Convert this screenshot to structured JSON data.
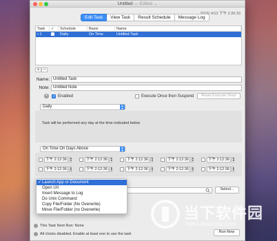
{
  "window": {
    "title": "Untitled",
    "edited": "— Edited ⌄",
    "clock": "2016/ 4/13 下午 2:26:33"
  },
  "tabs": [
    {
      "label": "Edit Task",
      "active": true
    },
    {
      "label": "View Task",
      "active": false
    },
    {
      "label": "Result Schedule",
      "active": false
    },
    {
      "label": "Message Log",
      "active": false
    }
  ],
  "task_table": {
    "columns": [
      "Task",
      "✓",
      "Schedule",
      "Basis",
      "Name"
    ],
    "rows": [
      {
        "task": "• 1",
        "checked": true,
        "schedule": "Daily",
        "basis": "On Time",
        "name": "Untitled Task"
      }
    ]
  },
  "table_controls": {
    "add": "+",
    "remove": "−"
  },
  "form": {
    "name_label": "Name:",
    "name_value": "Untitled Task",
    "note_label": "Note:",
    "note_value": "Untitled Note",
    "info_icon": "x",
    "enabled_label": "Enabled",
    "execute_once_label": "Execute Once then Suspend",
    "reset_button": "Reset Execute Once"
  },
  "schedule": {
    "selected": "Daily",
    "description": "Task will be performed any day at the time indicated below"
  },
  "time_basis": {
    "selected": "On Time On Days Above",
    "time_value": "下午 2:12:36"
  },
  "action_menu": {
    "items": [
      {
        "label": "Launch App or Document",
        "selected": true
      },
      {
        "label": "Open Url",
        "selected": false
      },
      {
        "label": "Insert Message to Log",
        "selected": false
      },
      {
        "label": "Do Unix Command",
        "selected": false
      },
      {
        "label": "Copy File/Folder (No Overwrite)",
        "selected": false
      },
      {
        "label": "Move File/Folder (no Overwrite)",
        "selected": false
      }
    ],
    "select_button": "Select..."
  },
  "footer": {
    "next_run": "This Task Next Run:  None",
    "clocks_note": "All clocks disabled. Enable at least one to use the task",
    "run_button": "Run Now"
  },
  "watermark": {
    "cn": "当下软件园",
    "url": "www.downxia.com"
  },
  "colors": {
    "accent": "#3d8ef6",
    "selection": "#2f6fd6",
    "window_bg": "#ececec"
  }
}
